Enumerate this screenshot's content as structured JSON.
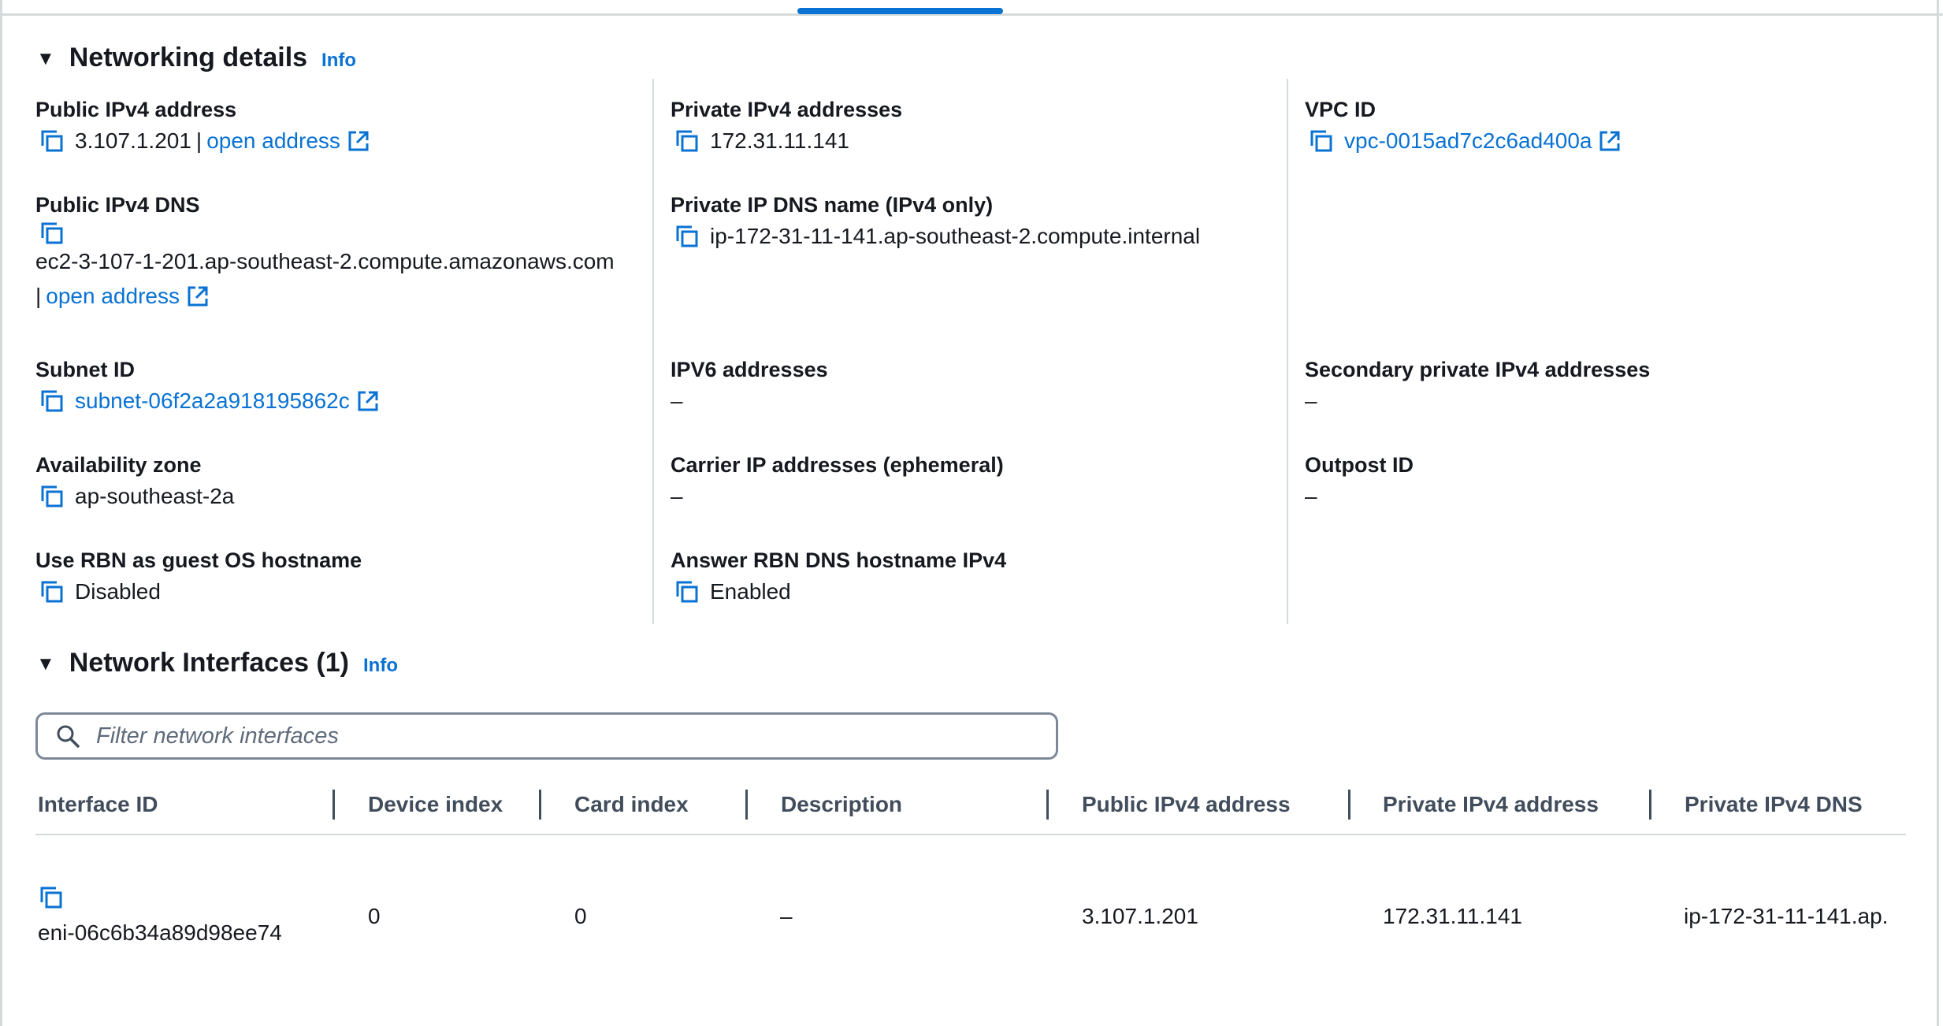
{
  "networking": {
    "title": "Networking details",
    "info": "Info",
    "fields": {
      "public_ipv4": {
        "label": "Public IPv4 address",
        "value": "3.107.1.201",
        "sep": "|",
        "open": "open address"
      },
      "private_ipv4": {
        "label": "Private IPv4 addresses",
        "value": "172.31.11.141"
      },
      "vpc": {
        "label": "VPC ID",
        "value": "vpc-0015ad7c2c6ad400a"
      },
      "public_dns": {
        "label": "Public IPv4 DNS",
        "value": "ec2-3-107-1-201.ap-southeast-2.compute.amazonaws.com",
        "sep": "|",
        "open": "open address"
      },
      "private_dns": {
        "label": "Private IP DNS name (IPv4 only)",
        "value": "ip-172-31-11-141.ap-southeast-2.compute.internal"
      },
      "subnet": {
        "label": "Subnet ID",
        "value": "subnet-06f2a2a918195862c"
      },
      "ipv6": {
        "label": "IPV6 addresses",
        "value": "–"
      },
      "secondary_private": {
        "label": "Secondary private IPv4 addresses",
        "value": "–"
      },
      "az": {
        "label": "Availability zone",
        "value": "ap-southeast-2a"
      },
      "carrier": {
        "label": "Carrier IP addresses (ephemeral)",
        "value": "–"
      },
      "outpost": {
        "label": "Outpost ID",
        "value": "–"
      },
      "rbn_hostname": {
        "label": "Use RBN as guest OS hostname",
        "value": "Disabled"
      },
      "rbn_dns": {
        "label": "Answer RBN DNS hostname IPv4",
        "value": "Enabled"
      }
    }
  },
  "interfaces": {
    "title": "Network Interfaces (1)",
    "info": "Info",
    "search_placeholder": "Filter network interfaces",
    "columns": [
      "Interface ID",
      "Device index",
      "Card index",
      "Description",
      "Public IPv4 address",
      "Private IPv4 address",
      "Private IPv4 DNS"
    ],
    "rows": [
      [
        "eni-06c6b34a89d98ee74",
        "0",
        "0",
        "–",
        "3.107.1.201",
        "172.31.11.141",
        "ip-172-31-11-141.ap."
      ]
    ]
  },
  "colors": {
    "link": "#0972d3",
    "text": "#16191f",
    "divider": "#d5dbdb"
  },
  "icons": [
    "copy-icon",
    "external-link-icon",
    "search-icon",
    "caret-down-icon"
  ]
}
